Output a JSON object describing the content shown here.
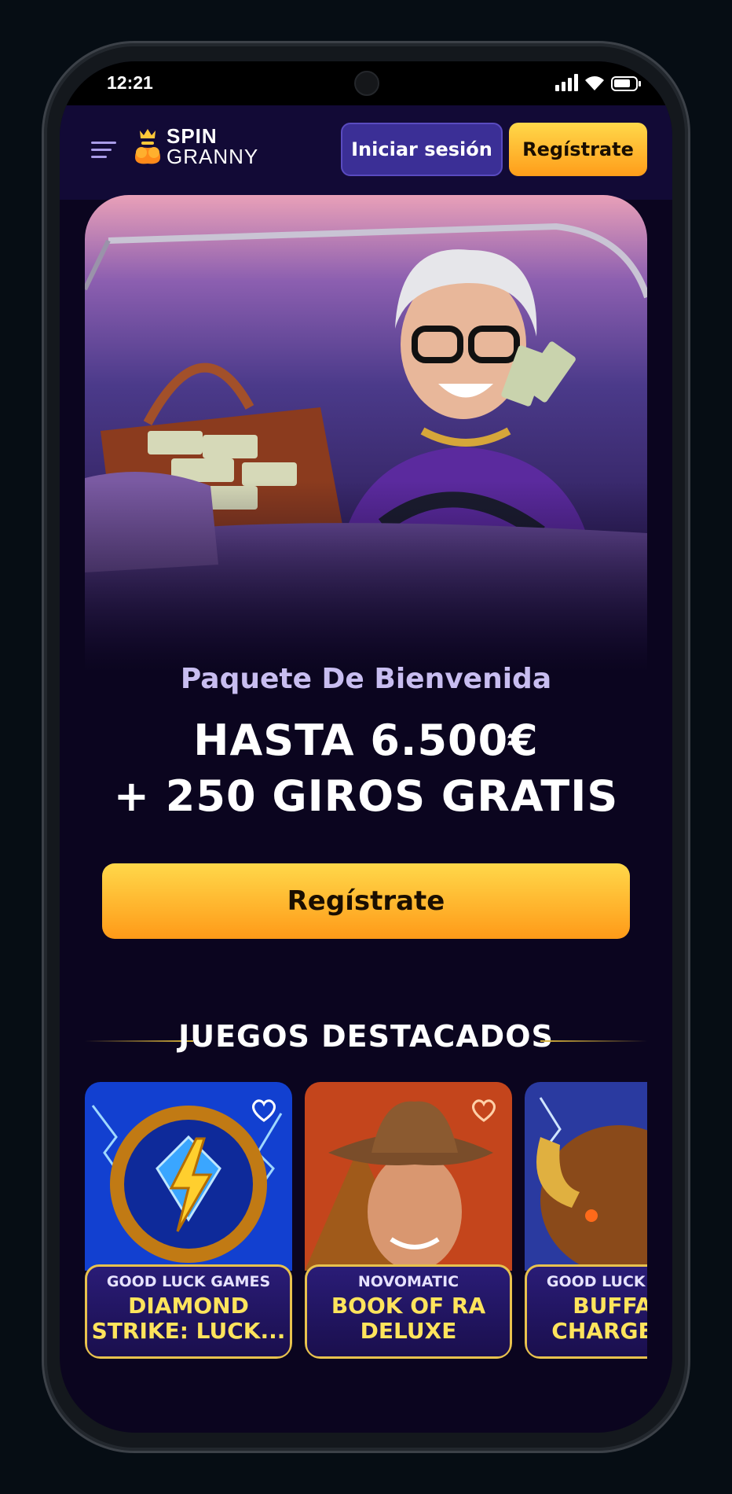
{
  "status_bar": {
    "time": "12:21"
  },
  "header": {
    "logo_line1": "SPIN",
    "logo_line2": "GRANNY",
    "login_label": "Iniciar sesión",
    "register_label": "Regístrate"
  },
  "promo": {
    "subtitle": "Paquete De Bienvenida",
    "line1": "HASTA 6.500€",
    "line2": "+ 250 GIROS GRATIS",
    "cta_label": "Regístrate"
  },
  "featured": {
    "title": "JUEGOS DESTACADOS",
    "games": [
      {
        "provider": "GOOD LUCK GAMES",
        "title": "DIAMOND STRIKE: LUCK..."
      },
      {
        "provider": "NOVOMATIC",
        "title": "BOOK OF RA DELUXE"
      },
      {
        "provider": "GOOD LUCK GAMES",
        "title": "BUFFALO CHARGE &..."
      }
    ]
  },
  "colors": {
    "accent_gold": "#ffc83a",
    "bg": "#0b051f",
    "primary_purple": "#3b2f96"
  }
}
